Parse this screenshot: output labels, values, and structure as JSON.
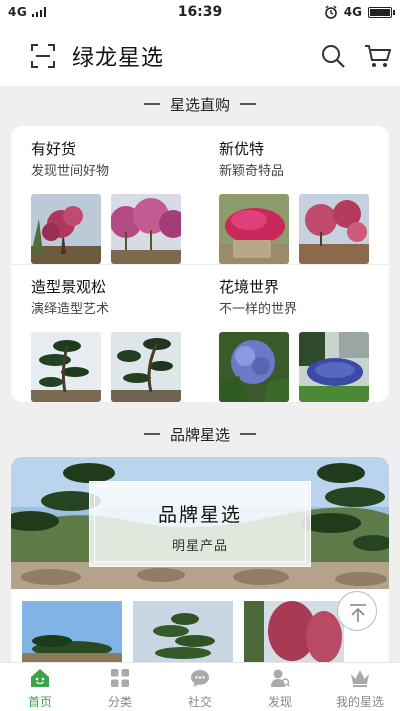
{
  "status_bar": {
    "network_left": "4G",
    "time": "16:39",
    "network_right": "4G",
    "battery_level": 0.9
  },
  "header": {
    "title": "绿龙星选",
    "scan_icon": "scan-icon",
    "search_icon": "search-icon",
    "cart_icon": "cart-icon"
  },
  "sections": {
    "featured_title": "星选直购",
    "brand_title": "品牌星选"
  },
  "featured": [
    {
      "title": "有好货",
      "subtitle": "发现世间好物"
    },
    {
      "title": "新优特",
      "subtitle": "新颖奇特品"
    },
    {
      "title": "造型景观松",
      "subtitle": "演绎造型艺术"
    },
    {
      "title": "花境世界",
      "subtitle": "不一样的世界"
    }
  ],
  "brand_banner": {
    "title": "品牌星选",
    "subtitle": "明星产品"
  },
  "tabs": [
    {
      "label": "首页",
      "icon": "home-icon",
      "active": true
    },
    {
      "label": "分类",
      "icon": "category-icon",
      "active": false
    },
    {
      "label": "社交",
      "icon": "chat-icon",
      "active": false
    },
    {
      "label": "发现",
      "icon": "discover-icon",
      "active": false
    },
    {
      "label": "我的星选",
      "icon": "crown-icon",
      "active": false
    }
  ],
  "colors": {
    "accent": "#3aa548",
    "background": "#efefef",
    "card": "#ffffff"
  }
}
